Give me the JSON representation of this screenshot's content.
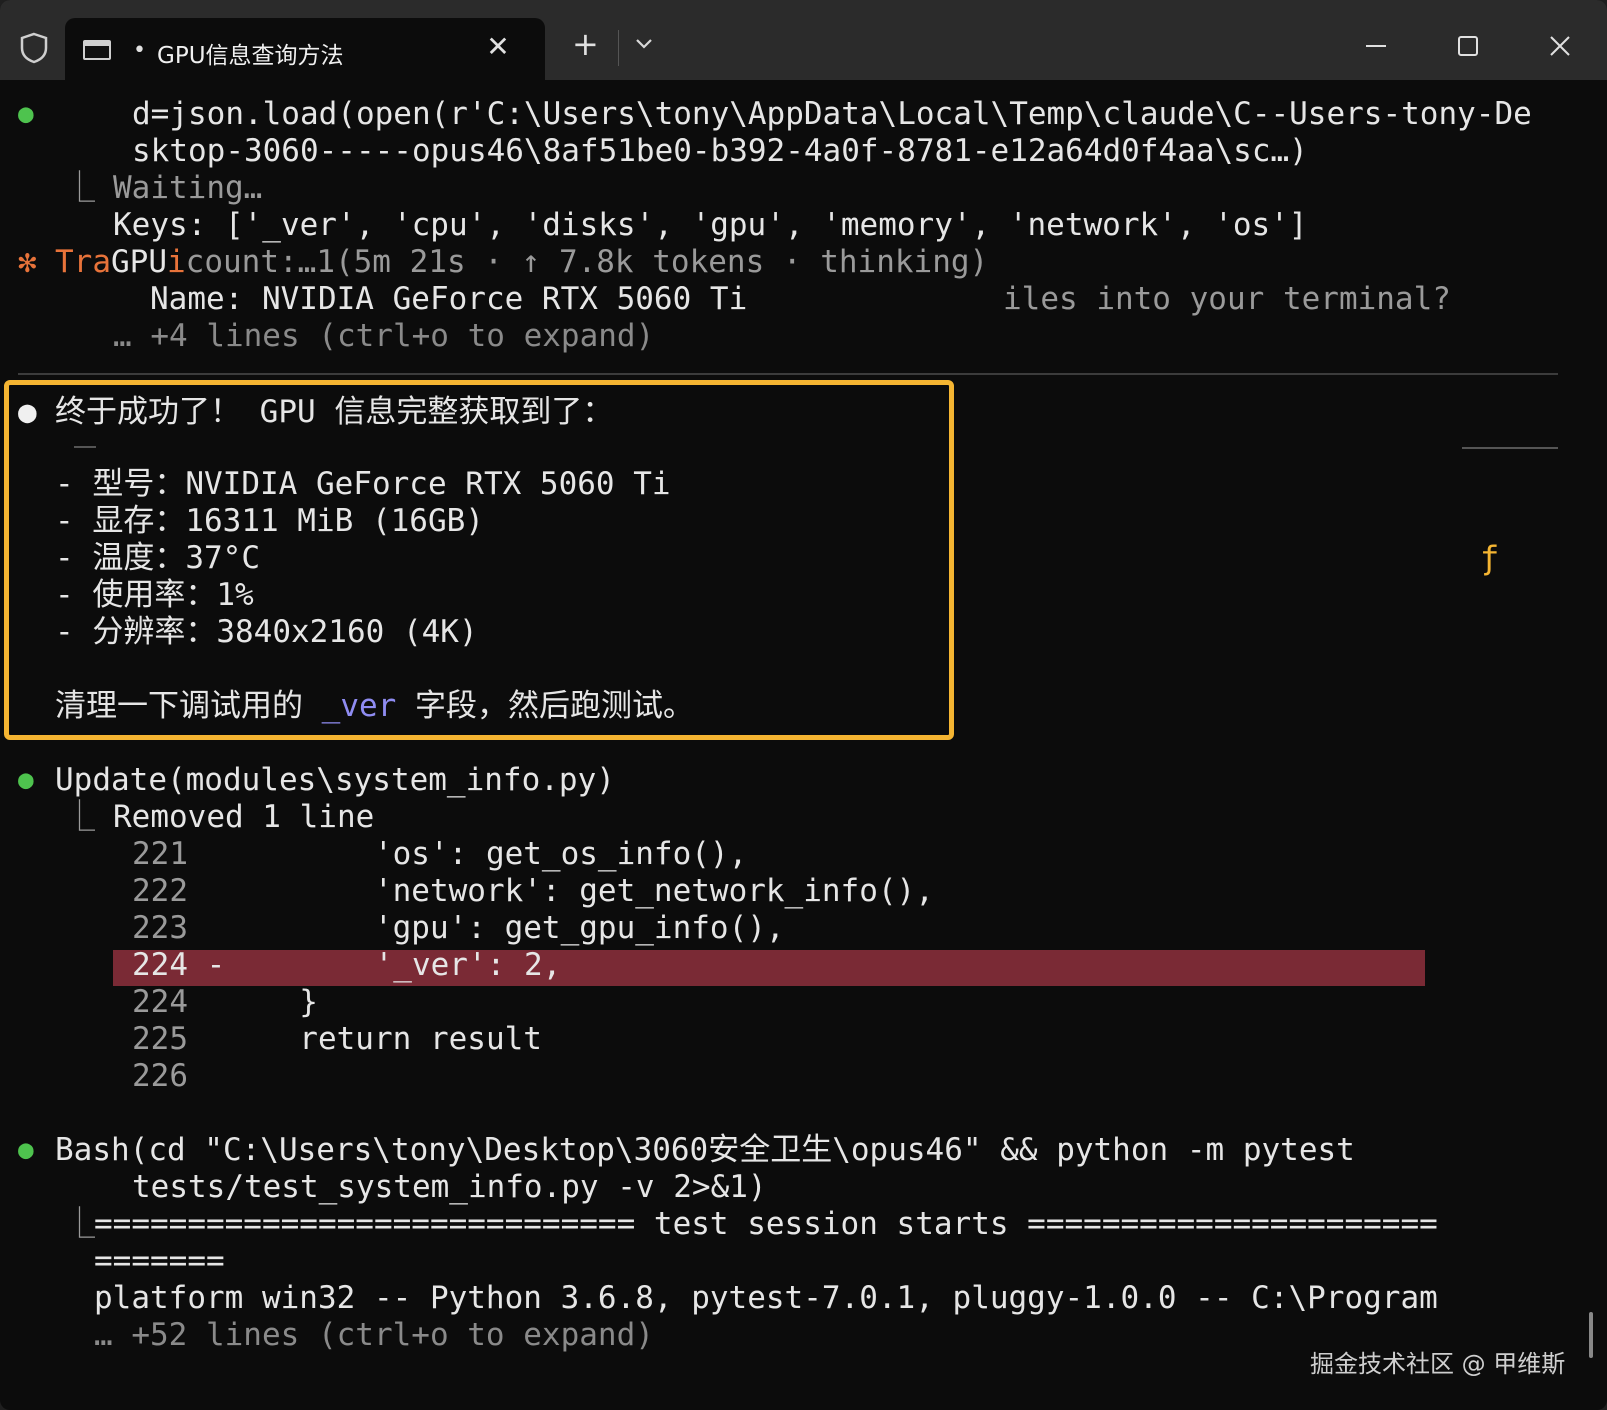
{
  "tab": {
    "title": "GPU信息查询方法",
    "dot": "•",
    "close": "✕",
    "new": "+",
    "dropdown": "⌄"
  },
  "lines": {
    "l1_bullet": "●",
    "l1": "d=json.load(open(r'C:\\Users\\tony\\AppData\\Local\\Temp\\claude\\C--Users-tony-De",
    "l2": "sktop-3060-----opus46\\8af51be0-b392-4a0f-8781-e12a64d0f4aa\\sc…)",
    "l3_corner": "⎿",
    "l3": "Waiting…",
    "l4": "Keys: ['_ver', 'cpu', 'disks', 'gpu', 'memory', 'network', 'os']",
    "l5_star": "✻",
    "l5_a": "Tra",
    "l5_b": "GPU",
    "l5_c": "i",
    "l5_d": "count:…1(5m 21s · ↑ 7.8k tokens · thinking)",
    "l6_a": "Name: NVIDIA GeForce RTX 5060 Ti",
    "l6_b": "iles into your terminal?",
    "l7": "… +4 lines (ctrl+o to expand)"
  },
  "summary": {
    "bullet": "●",
    "title": "终于成功了！ GPU 信息完整获取到了：",
    "items": [
      "- 型号：NVIDIA GeForce RTX 5060 Ti",
      "- 显存：16311 MiB (16GB)",
      "- 温度：37°C",
      "- 使用率：1%",
      "- 分辨率：3840x2160 (4K)"
    ],
    "footer_a": "清理一下调试用的 ",
    "footer_code": "_ver",
    "footer_b": " 字段，然后跑测试。",
    "side_glyph": "ƒ"
  },
  "update": {
    "bullet": "●",
    "title": "Update(modules\\system_info.py)",
    "corner": "⎿",
    "removed": "Removed 1 line",
    "rows": [
      {
        "n": "221",
        "code": "            'os': get_os_info(),"
      },
      {
        "n": "222",
        "code": "            'network': get_network_info(),"
      },
      {
        "n": "223",
        "code": "            'gpu': get_gpu_info(),"
      },
      {
        "n": "224 -",
        "code": "          '_ver': 2,"
      },
      {
        "n": "224",
        "code": "        }"
      },
      {
        "n": "225",
        "code": "        return result"
      },
      {
        "n": "226",
        "code": ""
      }
    ]
  },
  "bash": {
    "bullet": "●",
    "l1": "Bash(cd \"C:\\Users\\tony\\Desktop\\3060安全卫生\\opus46\" && python -m pytest",
    "l2": "tests/test_system_info.py -v 2>&1)",
    "corner": "⎿",
    "l3": "============================= test session starts ======================",
    "l4": "=======",
    "l5": "platform win32 -- Python 3.6.8, pytest-7.0.1, pluggy-1.0.0 -- C:\\Program",
    "l6": "… +52 lines (ctrl+o to expand)"
  },
  "watermark": "掘金技术社区 @ 甲维斯"
}
